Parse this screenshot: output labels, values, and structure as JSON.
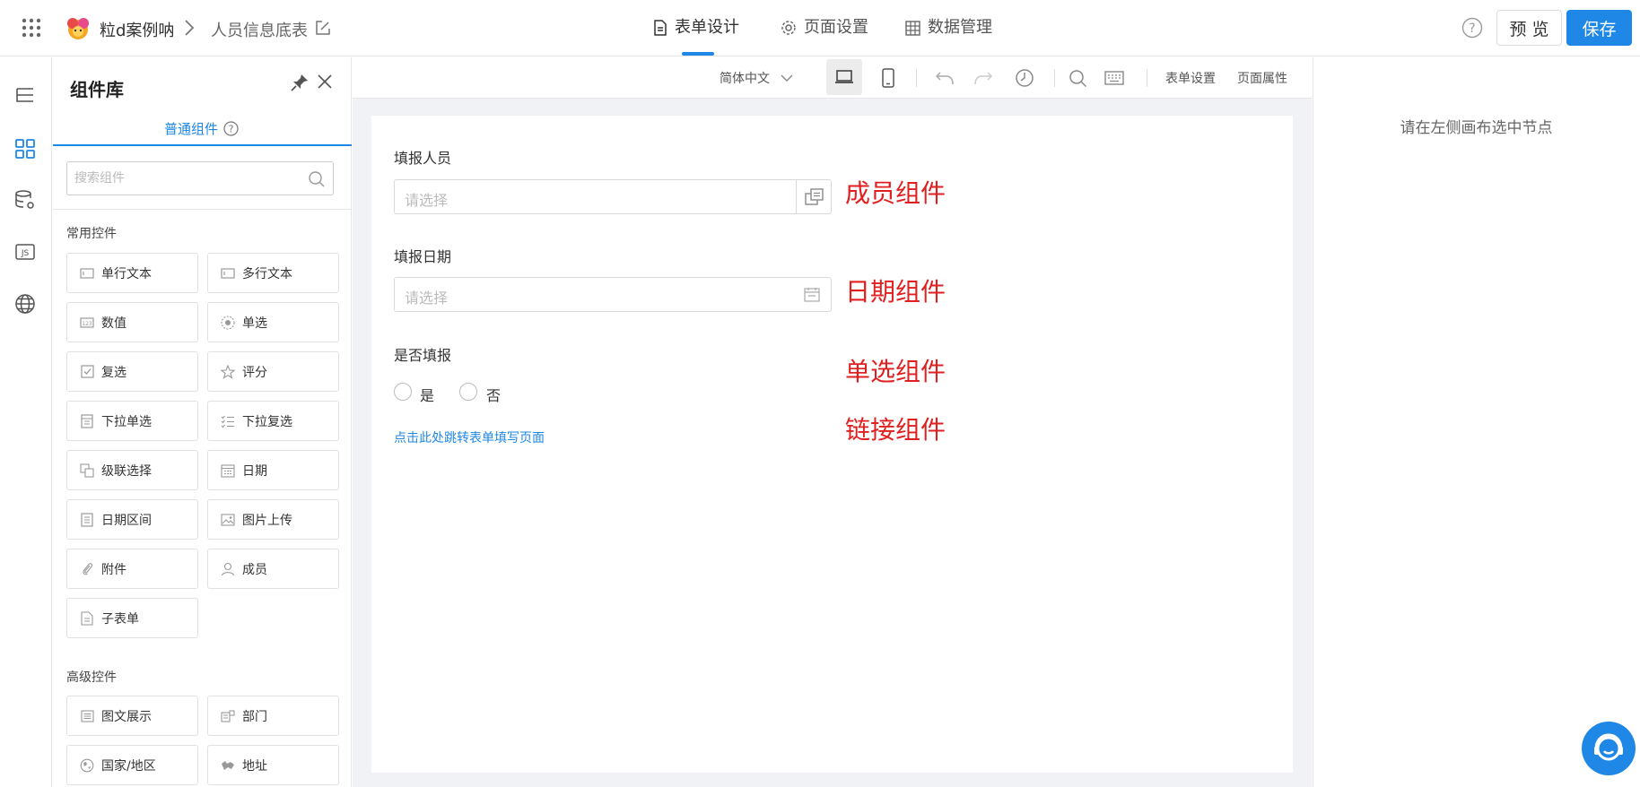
{
  "header": {
    "app_name": "粒d案例呐",
    "page_name": "人员信息底表",
    "tabs": [
      {
        "label": "表单设计",
        "icon": "file-icon",
        "active": true
      },
      {
        "label": "页面设置",
        "icon": "gear-icon",
        "active": false
      },
      {
        "label": "数据管理",
        "icon": "table-icon",
        "active": false
      }
    ],
    "preview_label": "预 览",
    "save_label": "保存",
    "accent_color": "#1f87e6"
  },
  "rail": {
    "items": [
      {
        "icon": "outline-tree-icon"
      },
      {
        "icon": "components-grid-icon",
        "active": true
      },
      {
        "icon": "data-source-icon"
      },
      {
        "icon": "js-icon"
      },
      {
        "icon": "globe-icon"
      }
    ]
  },
  "panel": {
    "title": "组件库",
    "tab_label": "普通组件",
    "search_placeholder": "搜索组件",
    "common_title": "常用控件",
    "common": [
      {
        "label": "单行文本",
        "icon": "single-line-text-icon"
      },
      {
        "label": "多行文本",
        "icon": "multi-line-text-icon"
      },
      {
        "label": "数值",
        "icon": "number-icon"
      },
      {
        "label": "单选",
        "icon": "radio-icon"
      },
      {
        "label": "复选",
        "icon": "checkbox-icon"
      },
      {
        "label": "评分",
        "icon": "star-icon"
      },
      {
        "label": "下拉单选",
        "icon": "dropdown-single-icon"
      },
      {
        "label": "下拉复选",
        "icon": "dropdown-multi-icon"
      },
      {
        "label": "级联选择",
        "icon": "cascader-icon"
      },
      {
        "label": "日期",
        "icon": "calendar-icon"
      },
      {
        "label": "日期区间",
        "icon": "date-range-icon"
      },
      {
        "label": "图片上传",
        "icon": "image-upload-icon"
      },
      {
        "label": "附件",
        "icon": "attachment-icon"
      },
      {
        "label": "成员",
        "icon": "member-icon"
      },
      {
        "label": "子表单",
        "icon": "subform-icon"
      }
    ],
    "advanced_title": "高级控件",
    "advanced": [
      {
        "label": "图文展示",
        "icon": "rich-text-icon"
      },
      {
        "label": "部门",
        "icon": "department-icon"
      },
      {
        "label": "国家/地区",
        "icon": "country-icon"
      },
      {
        "label": "地址",
        "icon": "address-icon"
      }
    ]
  },
  "toolbar": {
    "language": "简体中文",
    "form_settings": "表单设置",
    "page_props": "页面属性"
  },
  "form": {
    "fields": [
      {
        "label": "填报人员",
        "placeholder": "请选择",
        "annotation": "成员组件"
      },
      {
        "label": "填报日期",
        "placeholder": "请选择",
        "annotation": "日期组件"
      },
      {
        "label": "是否填报",
        "options": [
          "是",
          "否"
        ],
        "annotation": "单选组件"
      }
    ],
    "link_text": "点击此处跳转表单填写页面",
    "link_annotation": "链接组件",
    "annotation_color": "#e02020"
  },
  "right_panel": {
    "hint": "请在左侧画布选中节点"
  }
}
